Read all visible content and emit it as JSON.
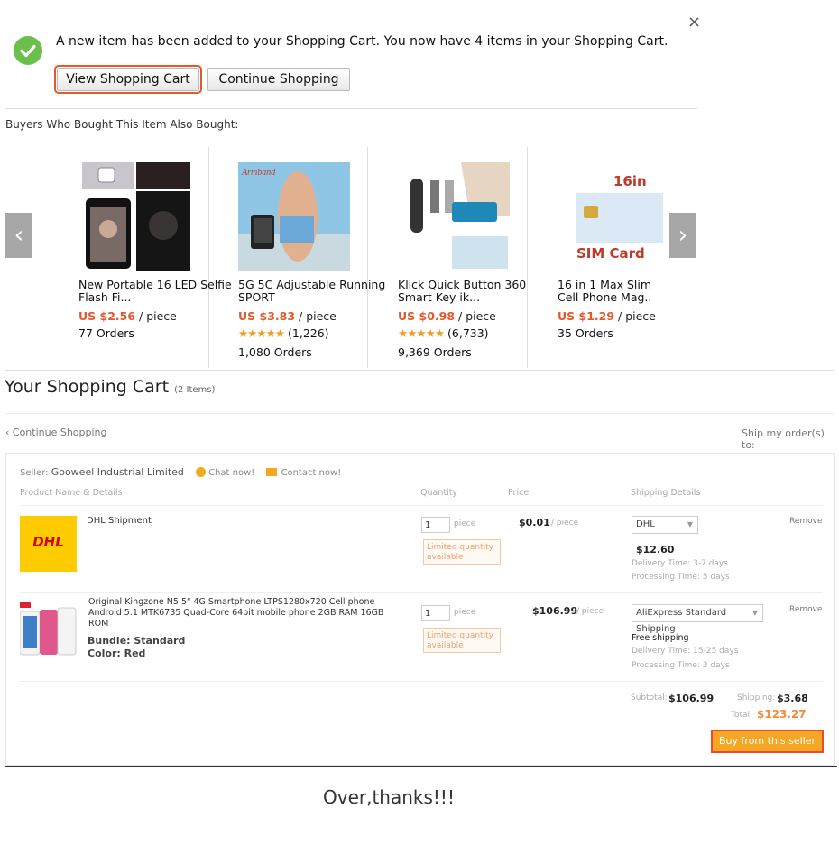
{
  "dialog": {
    "close": "×",
    "message": "A new item has been added to your Shopping Cart. You now have 4 items in your Shopping Cart.",
    "view_cart": "View Shopping Cart",
    "continue": "Continue Shopping"
  },
  "also_bought": {
    "heading": "Buyers Who Bought This Item Also Bought:",
    "prev": "‹",
    "next": "›",
    "products": [
      {
        "title": "New Portable 16 LED Selfie Flash Fi...",
        "price": "US $2.56",
        "unit": " / piece",
        "rating": "",
        "orders": "77 Orders"
      },
      {
        "title": "5G 5C Adjustable Running SPORT",
        "price": "US $3.83",
        "unit": " / piece",
        "rating": "(1,226)",
        "orders": "1,080 Orders",
        "img_text": "Armband"
      },
      {
        "title": "Klick Quick Button 360 Smart Key ik...",
        "price": "US $0.98",
        "unit": " / piece",
        "rating": "(6,733)",
        "orders": "9,369 Orders"
      },
      {
        "title": "16 in 1 Max Slim Cell Phone Mag..",
        "price": "US $1.29",
        "unit": " / piece",
        "rating": "",
        "orders": "35 Orders",
        "img_text1": "16in",
        "img_text2": "SIM Card"
      }
    ]
  },
  "cart": {
    "title": "Your Shopping Cart",
    "count": "(2 Items)",
    "continue": "‹ Continue Shopping",
    "ship_to": "Ship my order(s) to:",
    "seller_label": "Seller: ",
    "seller_name": "Gooweel Industrial Limited",
    "chat": "Chat now!",
    "contact": "Contact now!",
    "headers": {
      "product": "Product Name & Details",
      "quantity": "Quantity",
      "price": "Price",
      "shipping": "Shipping Details"
    },
    "items": [
      {
        "name": "DHL Shipment",
        "logo": "DHL",
        "qty": "1",
        "qty_unit": "piece",
        "limited": "Limited quantity available",
        "price": "$0.01",
        "price_unit": "/ piece",
        "shipping_method": "DHL",
        "shipping_cost": "$12.60",
        "delivery": "Delivery Time: 3-7 days",
        "processing": "Processing Time: 5 days",
        "remove": "Remove"
      },
      {
        "name": "Original Kingzone N5 5\" 4G Smartphone LTPS1280x720 Cell phone Android 5.1 MTK6735 Quad-Core 64bit mobile phone 2GB RAM 16GB ROM",
        "bundle": "Bundle: Standard",
        "color": "Color: Red",
        "qty": "1",
        "qty_unit": "piece",
        "limited": "Limited quantity available",
        "price": "$106.99",
        "price_unit": "/ piece",
        "shipping_method": "AliExpress Standard Shipping",
        "shipping_cost": "Free shipping",
        "delivery": "Delivery Time: 15-25 days",
        "processing": "Processing Time: 3 days",
        "remove": "Remove"
      }
    ],
    "subtotal_label": "Subtotal:",
    "subtotal": "$106.99",
    "shipping_label": "Shipping:",
    "shipping": "$3.68",
    "total_label": "Total:",
    "total": "$123.27",
    "buy": "Buy from this seller"
  },
  "footer_note": "Over,thanks!!!",
  "colors": {
    "accent": "#e4582b",
    "check": "#6bc04b",
    "stars": "#f29b1e",
    "buy": "#f5a623"
  }
}
